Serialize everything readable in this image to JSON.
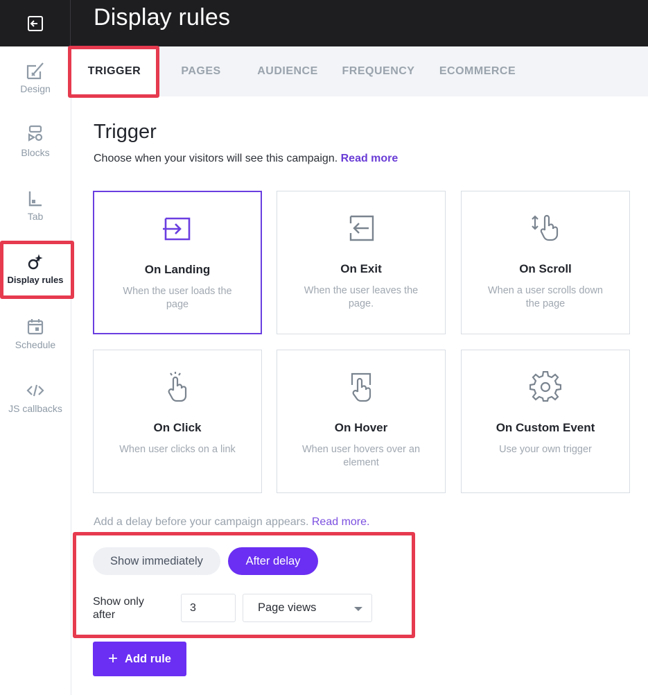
{
  "header": {
    "title": "Display rules"
  },
  "sidebar": {
    "items": [
      {
        "label": "Design",
        "icon": "design-brush-icon"
      },
      {
        "label": "Blocks",
        "icon": "blocks-icon"
      },
      {
        "label": "Tab",
        "icon": "tab-icon"
      },
      {
        "label": "Display rules",
        "icon": "display-rules-icon",
        "active": true
      },
      {
        "label": "Schedule",
        "icon": "calendar-icon"
      },
      {
        "label": "JS callbacks",
        "icon": "code-icon"
      }
    ]
  },
  "tabs": [
    {
      "label": "TRIGGER",
      "active": true
    },
    {
      "label": "PAGES"
    },
    {
      "label": "AUDIENCE"
    },
    {
      "label": "FREQUENCY"
    },
    {
      "label": "ECOMMERCE"
    }
  ],
  "trigger": {
    "title": "Trigger",
    "description": "Choose when your visitors will see this campaign.",
    "read_more": "Read more",
    "options": [
      {
        "title": "On Landing",
        "desc": "When the user loads the page",
        "icon": "enter-icon",
        "selected": true
      },
      {
        "title": "On Exit",
        "desc": "When the user leaves the page.",
        "icon": "exit-icon"
      },
      {
        "title": "On Scroll",
        "desc": "When a user scrolls down the page",
        "icon": "scroll-hand-icon"
      },
      {
        "title": "On Click",
        "desc": "When user clicks on a link",
        "icon": "click-hand-icon"
      },
      {
        "title": "On Hover",
        "desc": "When user hovers over an element",
        "icon": "hover-hand-icon"
      },
      {
        "title": "On Custom Event",
        "desc": "Use your own trigger",
        "icon": "gear-icon"
      }
    ]
  },
  "delay": {
    "text": "Add a delay before your campaign appears.",
    "read_more": "Read more.",
    "show_immediately": "Show immediately",
    "after_delay": "After delay",
    "show_only_after": "Show only after",
    "value": "3",
    "unit": "Page views"
  },
  "add_rule": {
    "label": "Add rule"
  },
  "colors": {
    "accent": "#6a2ff2",
    "highlight": "#e63a4f",
    "header_bg": "#1e1e21"
  }
}
